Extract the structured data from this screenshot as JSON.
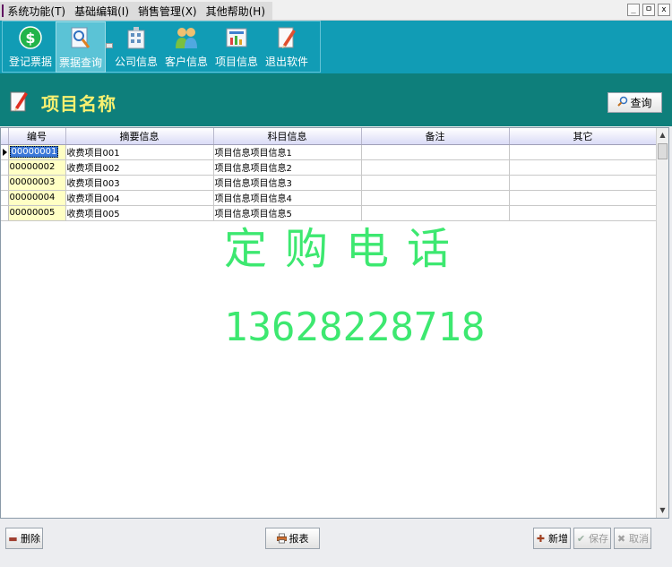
{
  "menubar": {
    "items": [
      "系统功能(T)",
      "基础编辑(I)",
      "销售管理(X)",
      "其他帮助(H)"
    ],
    "window_controls": [
      "_",
      "ㅁ",
      "x"
    ]
  },
  "toolbar": {
    "buttons": [
      {
        "label": "登记票据",
        "icon": "dollar-icon"
      },
      {
        "label": "票据查询",
        "icon": "magnifier-icon"
      },
      {
        "label": "公司信息",
        "icon": "building-icon"
      },
      {
        "label": "客户信息",
        "icon": "users-icon"
      },
      {
        "label": "项目信息",
        "icon": "chart-icon"
      },
      {
        "label": "退出软件",
        "icon": "pencil-icon"
      }
    ]
  },
  "header": {
    "title": "项目名称",
    "query_label": "查询"
  },
  "grid": {
    "columns": [
      "编号",
      "摘要信息",
      "科目信息",
      "备注",
      "其它"
    ],
    "rows": [
      [
        "00000001",
        "收费项目001",
        "项目信息项目信息1",
        "",
        ""
      ],
      [
        "00000002",
        "收费项目002",
        "项目信息项目信息2",
        "",
        ""
      ],
      [
        "00000003",
        "收费项目003",
        "项目信息项目信息3",
        "",
        ""
      ],
      [
        "00000004",
        "收费项目004",
        "项目信息项目信息4",
        "",
        ""
      ],
      [
        "00000005",
        "收费项目005",
        "项目信息项目信息5",
        "",
        ""
      ]
    ]
  },
  "watermark": {
    "line1": "定购电话",
    "line2": "13628228718"
  },
  "bottom": {
    "delete_label": "删除",
    "report_label": "报表",
    "new_label": "新增",
    "save_label": "保存",
    "cancel_label": "取消"
  },
  "colors": {
    "toolbar_bg": "#119cb5",
    "header_bg": "#0e7f7b",
    "title_color": "#f7f070",
    "watermark": "#3de870"
  }
}
